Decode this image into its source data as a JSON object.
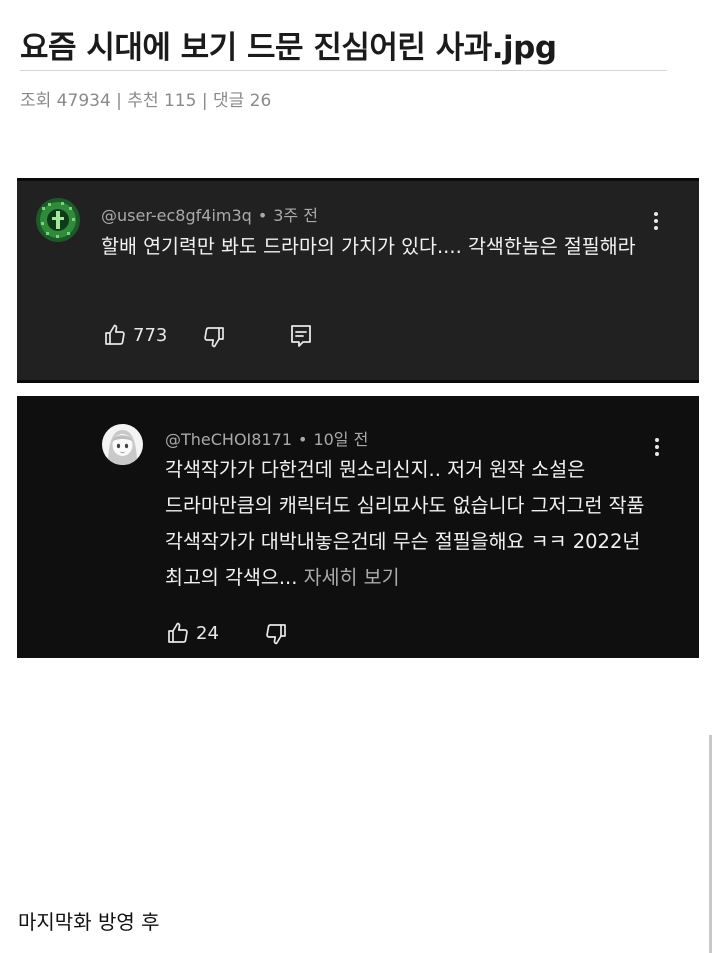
{
  "post": {
    "title": "요즘 시대에 보기 드문 진심어린 사과.jpg",
    "meta": "조회 47934 | 추천 115 | 댓글 26",
    "caption": "마지막화 방영 후"
  },
  "comments": [
    {
      "author": "@user-ec8gf4im3q",
      "separator": "•",
      "time": "3주 전",
      "text": "할배 연기력만 봐도 드라마의 가치가 있다.... 각색한놈은 절필해라",
      "likes": "773"
    },
    {
      "author": "@TheCHOI8171",
      "separator": "•",
      "time": "10일 전",
      "text": "각색작가가 다한건데 뭔소리신지.. 저거 원작 소설은 드라마만큼의 캐릭터도 심리묘사도 없습니다 그저그런 작품 각색작가가 대박내놓은건데 무슨 절필을해요 ㅋㅋ 2022년 최고의 각색으... ",
      "more_label": "자세히 보기",
      "likes": "24"
    }
  ],
  "icons": {
    "like": "thumbs-up-icon",
    "dislike": "thumbs-down-icon",
    "reply": "reply-icon",
    "menu": "more-vertical-icon"
  }
}
